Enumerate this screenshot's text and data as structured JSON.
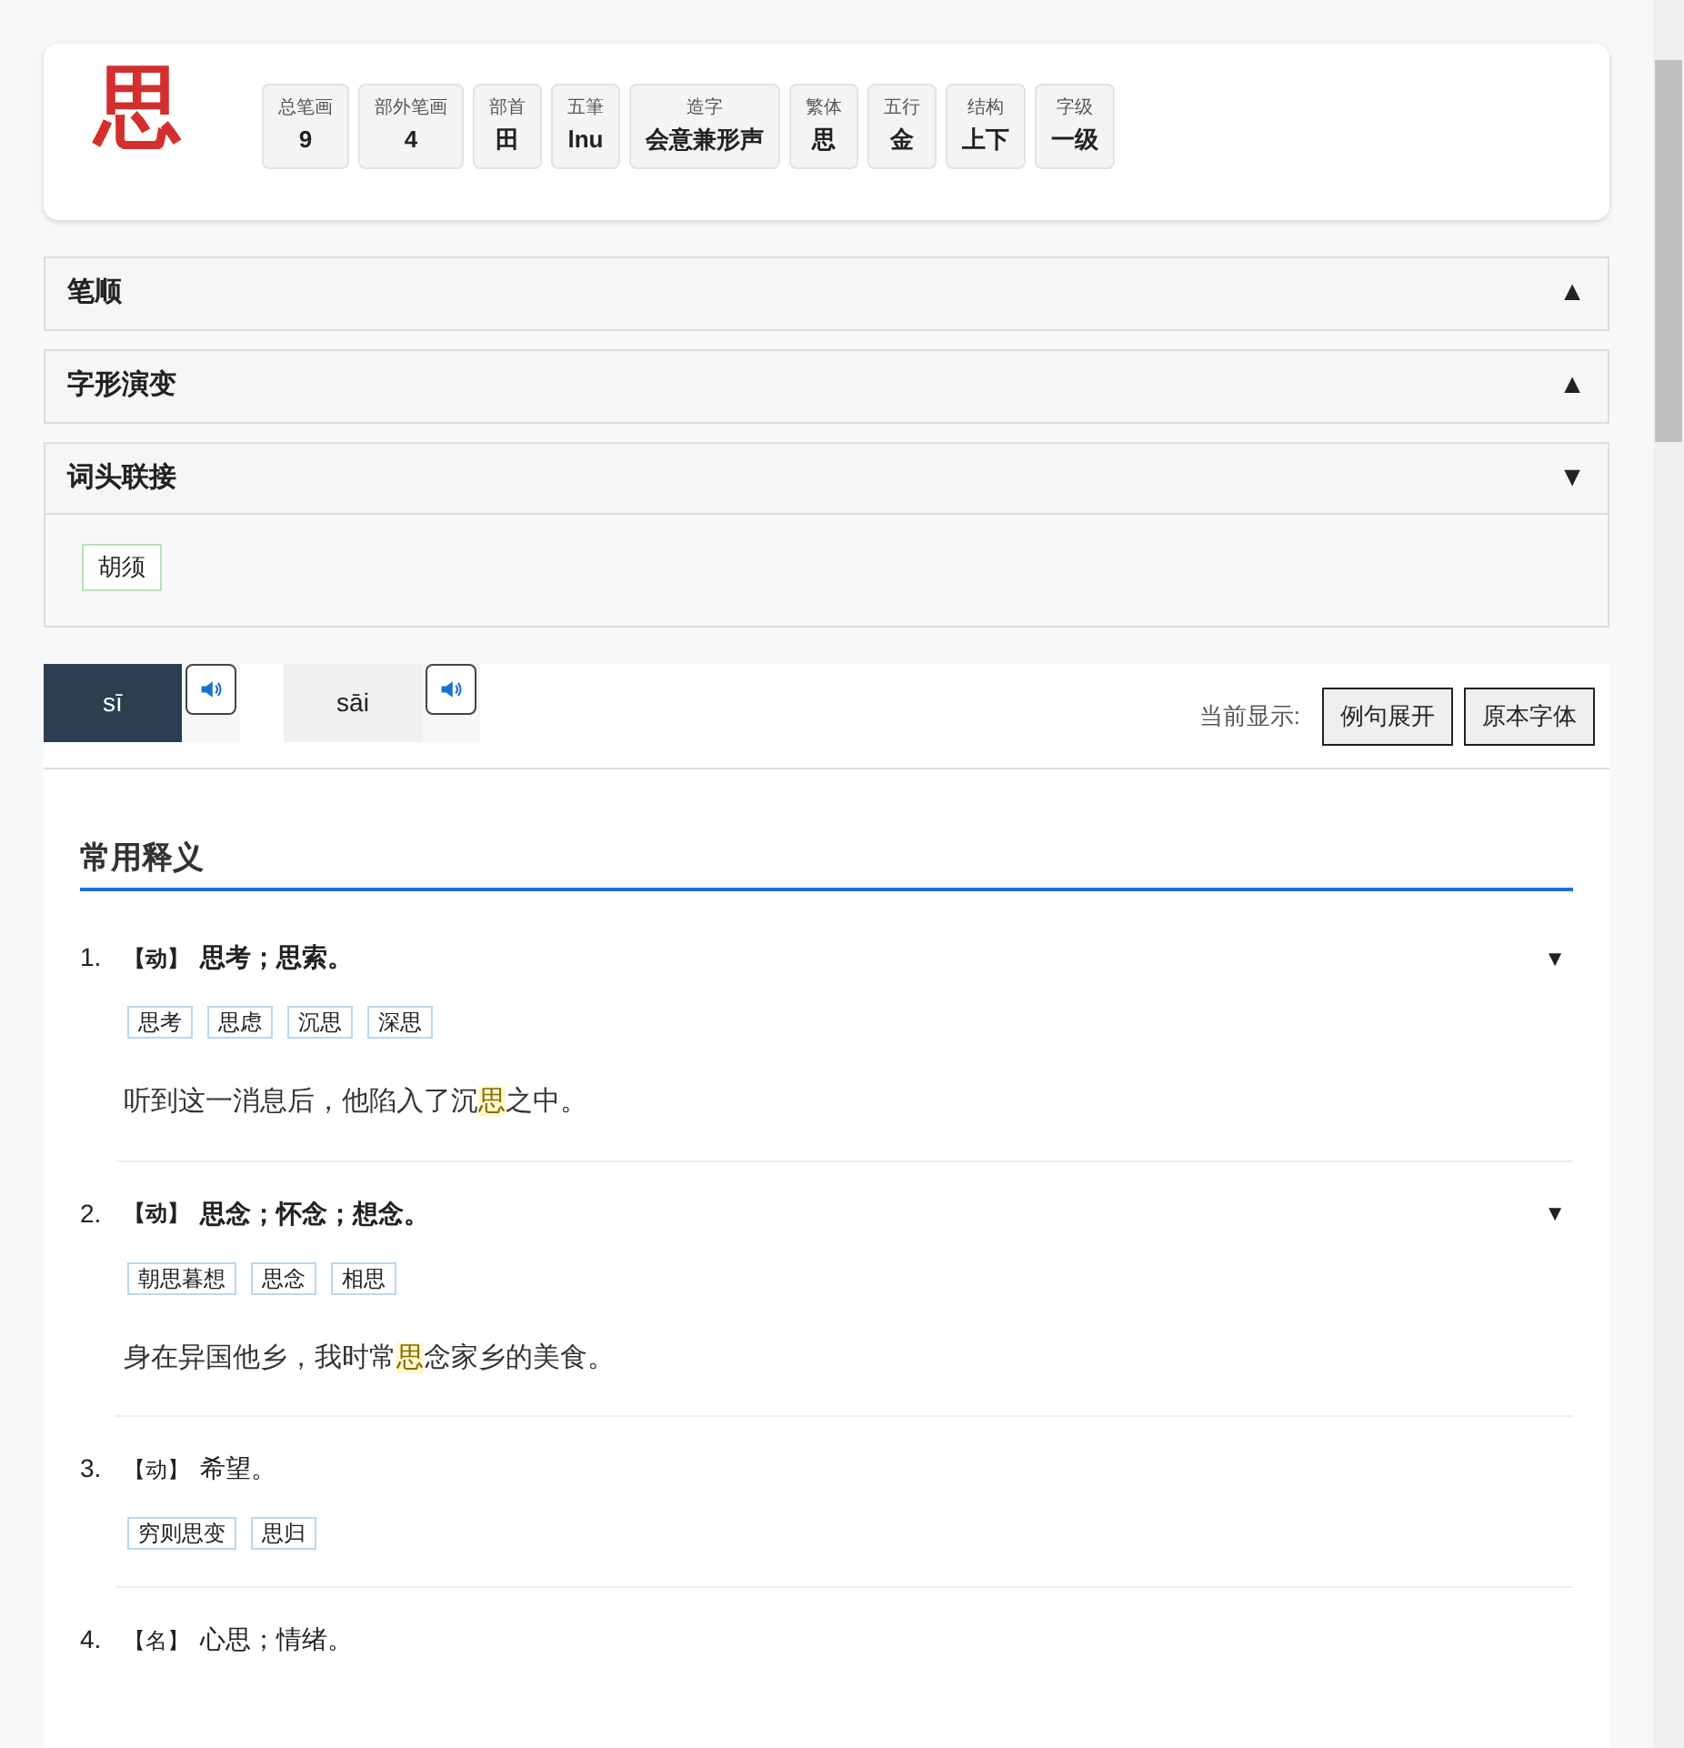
{
  "character": "思",
  "attributes": [
    {
      "label": "总笔画",
      "value": "9"
    },
    {
      "label": "部外笔画",
      "value": "4"
    },
    {
      "label": "部首",
      "value": "田"
    },
    {
      "label": "五筆",
      "value": "lnu"
    },
    {
      "label": "造字",
      "value": "会意兼形声"
    },
    {
      "label": "繁体",
      "value": "思"
    },
    {
      "label": "五行",
      "value": "金"
    },
    {
      "label": "结构",
      "value": "上下"
    },
    {
      "label": "字级",
      "value": "一级"
    }
  ],
  "sections": [
    {
      "title": "笔顺",
      "toggle": "▲",
      "expanded": false
    },
    {
      "title": "字形演变",
      "toggle": "▲",
      "expanded": false
    },
    {
      "title": "词头联接",
      "toggle": "▼",
      "expanded": true,
      "words": [
        "胡须"
      ]
    }
  ],
  "pronunciations": [
    {
      "label": "sī",
      "selected": true
    },
    {
      "label": "sāi",
      "selected": false
    }
  ],
  "display": {
    "label": "当前显示:",
    "buttons": [
      "例句展开",
      "原本字体"
    ]
  },
  "heading": "常用释义",
  "definitions": [
    {
      "number": "1.",
      "pos": "【动】",
      "text": "思考；思索。",
      "kind": "detailed",
      "toggle": "▼",
      "tags": [
        "思考",
        "思虑",
        "沉思",
        "深思"
      ],
      "example": {
        "before": "听到这一消息后，他陷入了沉",
        "highlight": "思",
        "after": "之中。"
      }
    },
    {
      "number": "2.",
      "pos": "【动】",
      "text": "思念；怀念；想念。",
      "kind": "detailed",
      "toggle": "▼",
      "tags": [
        "朝思暮想",
        "思念",
        "相思"
      ],
      "example": {
        "before": "身在异国他乡，我时常",
        "highlight": "思",
        "after": "念家乡的美食。"
      }
    },
    {
      "number": "3.",
      "pos": "【动】",
      "text": "希望。",
      "kind": "simple",
      "tags": [
        "穷则思变",
        "思归"
      ]
    },
    {
      "number": "4.",
      "pos": "【名】",
      "text": "心思；情绪。",
      "kind": "simple"
    }
  ]
}
